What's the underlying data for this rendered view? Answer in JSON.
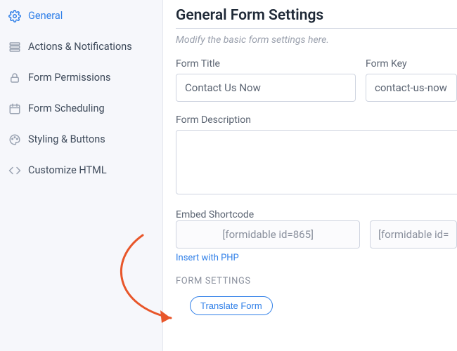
{
  "sidebar": {
    "items": [
      {
        "label": "General"
      },
      {
        "label": "Actions & Notifications"
      },
      {
        "label": "Form Permissions"
      },
      {
        "label": "Form Scheduling"
      },
      {
        "label": "Styling & Buttons"
      },
      {
        "label": "Customize HTML"
      }
    ]
  },
  "main": {
    "page_title": "General Form Settings",
    "subtitle": "Modify the basic form settings here.",
    "form_title_label": "Form Title",
    "form_title_value": "Contact Us Now",
    "form_key_label": "Form Key",
    "form_key_value": "contact-us-now",
    "form_desc_label": "Form Description",
    "form_desc_value": "",
    "embed_label": "Embed Shortcode",
    "shortcode_primary": "[formidable id=865]",
    "shortcode_secondary": "[formidable id=",
    "insert_php_link": "Insert with PHP",
    "section_heading": "FORM SETTINGS",
    "translate_btn": "Translate Form"
  }
}
